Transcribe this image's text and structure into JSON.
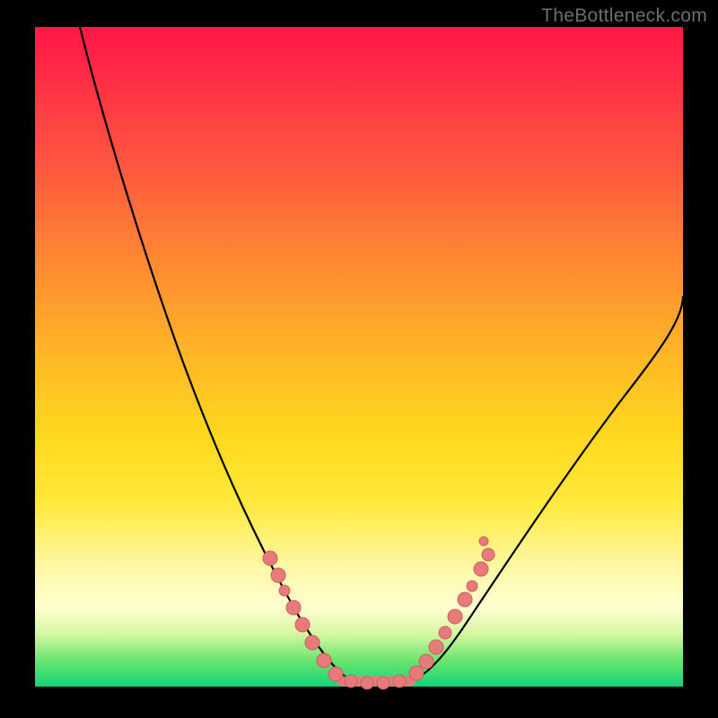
{
  "watermark": "TheBottleneck.com",
  "colors": {
    "frame": "#000000",
    "curve": "#000000",
    "dots": "#e77b7b",
    "gradient_top": "#ff1648",
    "gradient_bottom": "#17d37a"
  },
  "chart_data": {
    "type": "line",
    "title": "",
    "xlabel": "",
    "ylabel": "",
    "xlim": [
      0,
      100
    ],
    "ylim": [
      0,
      100
    ],
    "grid": false,
    "legend": false,
    "series": [
      {
        "name": "bottleneck-curve",
        "x": [
          7,
          12,
          17,
          23,
          28,
          33,
          37,
          40,
          43,
          46,
          48,
          50,
          53,
          56,
          58,
          61,
          64,
          68,
          73,
          79,
          86,
          94,
          100
        ],
        "y": [
          100,
          86,
          73,
          59,
          47,
          36,
          27,
          21,
          15,
          9,
          4,
          0,
          0,
          0,
          3,
          8,
          14,
          21,
          29,
          38,
          47,
          55,
          60
        ]
      }
    ],
    "markers": [
      {
        "name": "left-cluster",
        "x": [
          33,
          35,
          37,
          39,
          41,
          43,
          45
        ],
        "y": [
          36,
          32,
          27,
          23,
          19,
          15,
          10
        ]
      },
      {
        "name": "bottom-flat",
        "x": [
          48,
          50,
          52,
          54,
          56
        ],
        "y": [
          0.5,
          0,
          0,
          0,
          0.5
        ]
      },
      {
        "name": "right-cluster",
        "x": [
          58,
          60,
          62,
          64,
          66,
          68
        ],
        "y": [
          4,
          7,
          11,
          14,
          18,
          21
        ]
      }
    ],
    "annotations": []
  }
}
